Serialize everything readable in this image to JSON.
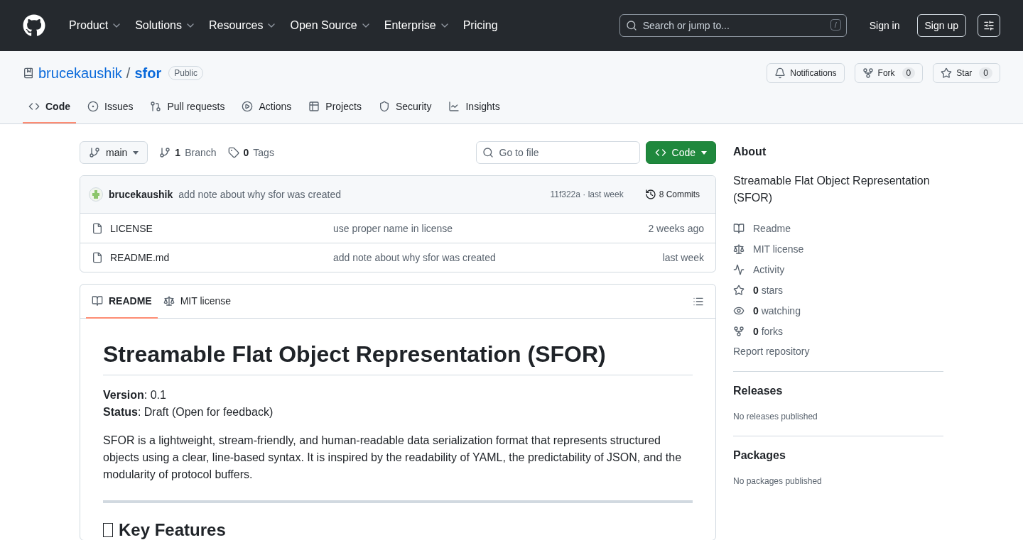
{
  "header": {
    "nav": [
      {
        "label": "Product",
        "has_menu": true
      },
      {
        "label": "Solutions",
        "has_menu": true
      },
      {
        "label": "Resources",
        "has_menu": true
      },
      {
        "label": "Open Source",
        "has_menu": true
      },
      {
        "label": "Enterprise",
        "has_menu": true
      },
      {
        "label": "Pricing",
        "has_menu": false
      }
    ],
    "search": {
      "placeholder": "Search or jump to...",
      "shortcut": "/"
    },
    "sign_in": "Sign in",
    "sign_up": "Sign up"
  },
  "repo": {
    "owner": "brucekaushik",
    "separator": "/",
    "name": "sfor",
    "visibility": "Public",
    "notifications": "Notifications",
    "fork": {
      "label": "Fork",
      "count": "0"
    },
    "star": {
      "label": "Star",
      "count": "0"
    }
  },
  "tabs": [
    {
      "label": "Code",
      "selected": true
    },
    {
      "label": "Issues",
      "selected": false
    },
    {
      "label": "Pull requests",
      "selected": false
    },
    {
      "label": "Actions",
      "selected": false
    },
    {
      "label": "Projects",
      "selected": false
    },
    {
      "label": "Security",
      "selected": false
    },
    {
      "label": "Insights",
      "selected": false
    }
  ],
  "toolbar": {
    "branch": "main",
    "branches": {
      "count": "1",
      "label": "Branch"
    },
    "tags": {
      "count": "0",
      "label": "Tags"
    },
    "go_to_file": {
      "placeholder": "Go to file"
    },
    "code_button": "Code"
  },
  "commit": {
    "author": "brucekaushik",
    "message": "add note about why sfor was created",
    "hash_time": "11f322a · last week",
    "commits": "8 Commits"
  },
  "files": [
    {
      "name": "LICENSE",
      "message": "use proper name in license",
      "time": "2 weeks ago"
    },
    {
      "name": "README.md",
      "message": "add note about why sfor was created",
      "time": "last week"
    }
  ],
  "readme": {
    "tabs": [
      {
        "label": "README",
        "selected": true
      },
      {
        "label": "MIT license",
        "selected": false
      }
    ],
    "title": "Streamable Flat Object Representation (SFOR)",
    "meta": [
      "**Version**: 0.1",
      "**Status**: Draft (Open for feedback)"
    ],
    "paragraph": "SFOR is a lightweight, stream-friendly, and human-readable data serialization format that represents structured objects using a clear, line-based syntax. It is inspired by the readability of YAML, the predictability of JSON, and the modularity of protocol buffers.",
    "next_heading": "Key Features"
  },
  "sidebar": {
    "about": "About",
    "description": "Streamable Flat Object Representation (SFOR)",
    "links": [
      {
        "label": "Readme"
      },
      {
        "label": "MIT license"
      },
      {
        "label": "Activity"
      },
      {
        "label": "**0** stars"
      },
      {
        "label": "**0** watching"
      },
      {
        "label": "**0** forks"
      }
    ],
    "report": "Report repository",
    "sections": [
      {
        "heading": "Releases",
        "text": "No releases published"
      },
      {
        "heading": "Packages",
        "text": "No packages published"
      }
    ]
  }
}
